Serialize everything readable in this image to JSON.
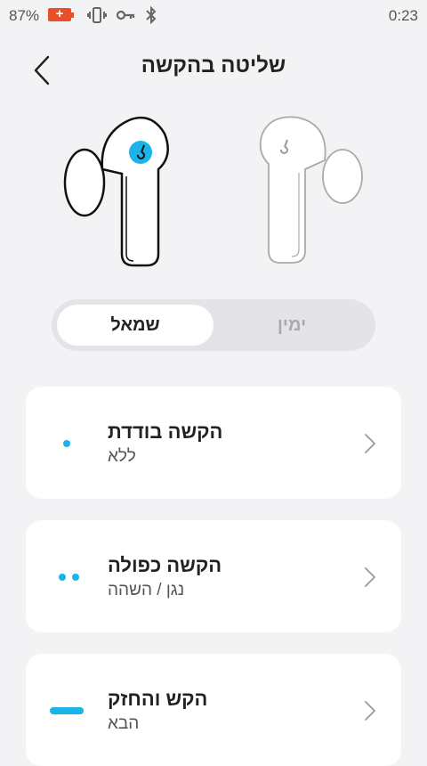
{
  "status_bar": {
    "battery_percent": "87%",
    "time": "0:23"
  },
  "header": {
    "title": "שליטה בהקשה"
  },
  "earbuds": {
    "selected_color": "#1ab3ea"
  },
  "side_selector": {
    "left_label": "שמאל",
    "right_label": "ימין",
    "selected": "שמאל"
  },
  "gestures": [
    {
      "title": "הקשה בודדת",
      "action": "ללא",
      "icon": "single-dot-icon"
    },
    {
      "title": "הקשה כפולה",
      "action": "נגן / השהה",
      "icon": "double-dot-icon"
    },
    {
      "title": "הקש והחזק",
      "action": "הבא",
      "icon": "long-bar-icon"
    }
  ],
  "colors": {
    "accent": "#1ab3ea",
    "background": "#f3f3f5",
    "card": "#ffffff"
  }
}
